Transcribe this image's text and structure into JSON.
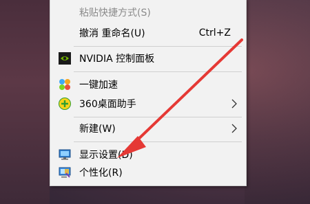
{
  "menu": {
    "items": [
      {
        "label": "粘贴快捷方式(S)",
        "disabled": true
      },
      {
        "label": "撤消 重命名(U)",
        "shortcut": "Ctrl+Z"
      },
      {
        "label": "NVIDIA 控制面板",
        "icon": "nvidia-icon"
      },
      {
        "label": "一键加速",
        "icon": "speedup-icon"
      },
      {
        "label": "360桌面助手",
        "icon": "360-desktop-icon",
        "submenu": true
      },
      {
        "label": "新建(W)",
        "submenu": true
      },
      {
        "label": "显示设置(D)",
        "icon": "display-icon"
      },
      {
        "label": "个性化(R)",
        "icon": "personalize-icon"
      }
    ]
  },
  "colors": {
    "menu_bg": "#f2f2f2",
    "arrow": "#e53935",
    "nvidia_green": "#76b900"
  }
}
